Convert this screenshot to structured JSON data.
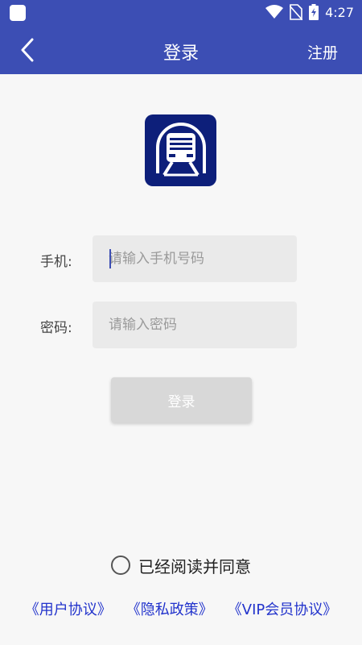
{
  "colors": {
    "primary": "#3c4eb4",
    "logo_bg": "#0d1f7a",
    "link": "#2233cc",
    "input_bg": "#eaeaea",
    "button_disabled": "#d8d8d8"
  },
  "statusbar": {
    "time": "4:27",
    "icons": [
      "wifi-icon",
      "no-sim-icon",
      "battery-charging-icon"
    ]
  },
  "toolbar": {
    "back_icon": "chevron-left-icon",
    "title": "登录",
    "register_label": "注册"
  },
  "logo": {
    "icon": "subway-train-icon"
  },
  "form": {
    "phone": {
      "label": "手机:",
      "placeholder": "请输入手机号码",
      "value": ""
    },
    "password": {
      "label": "密码:",
      "placeholder": "请输入密码",
      "value": ""
    }
  },
  "login_button": {
    "label": "登录"
  },
  "agreement": {
    "checked": false,
    "text": "已经阅读并同意",
    "links": [
      "《用户协议》",
      "《隐私政策》",
      "《VIP会员协议》"
    ]
  }
}
